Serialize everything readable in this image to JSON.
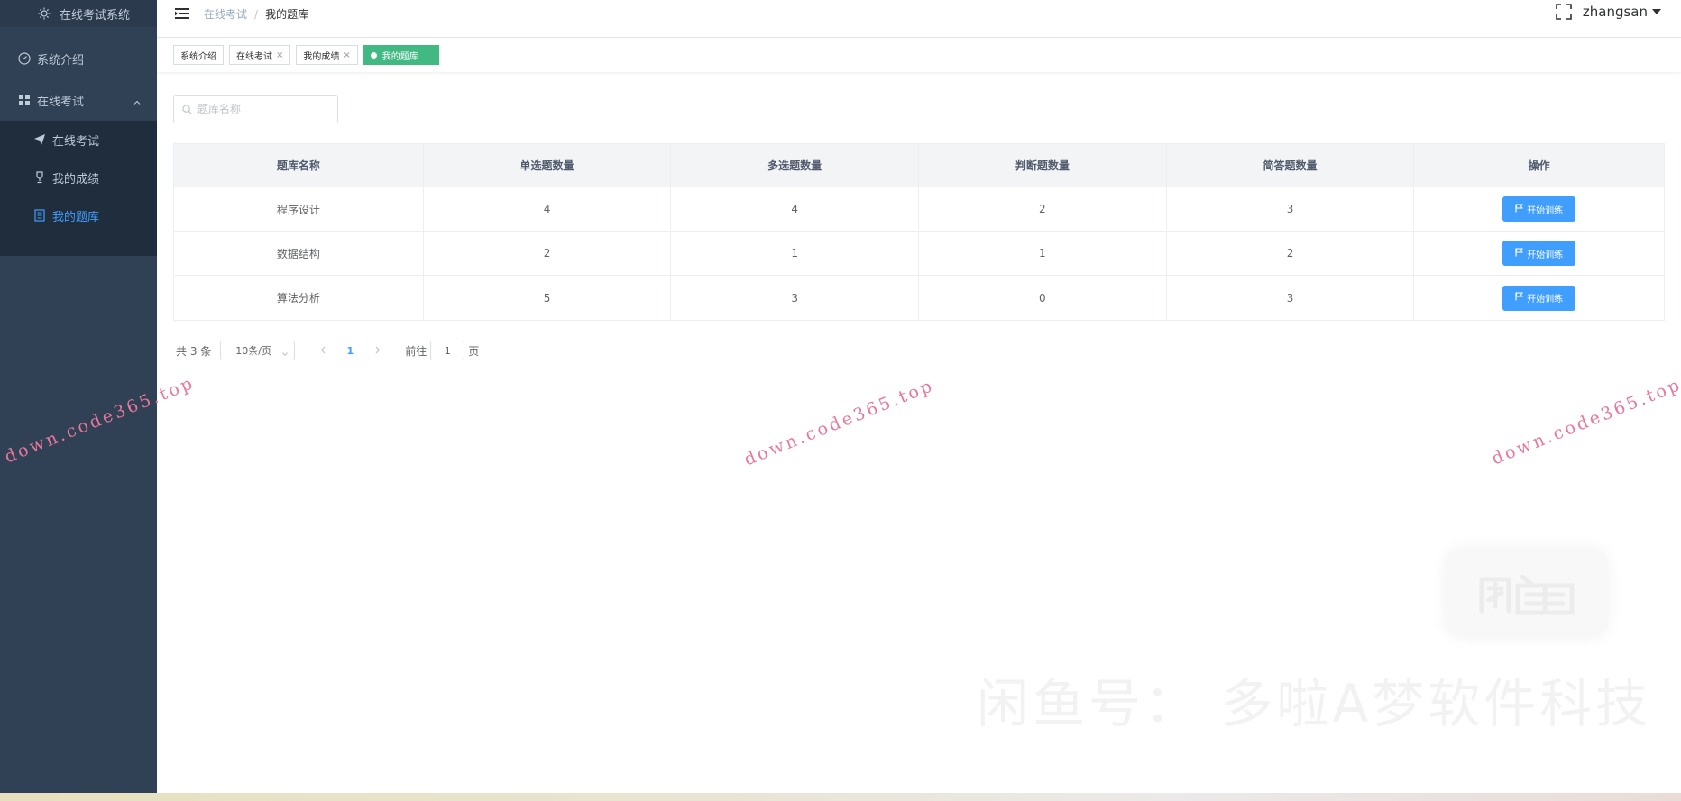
{
  "sidebar": {
    "logo_title": "在线考试系统",
    "items": [
      {
        "label": "系统介绍"
      },
      {
        "label": "在线考试"
      }
    ],
    "sub_items": [
      {
        "label": "在线考试"
      },
      {
        "label": "我的成绩"
      },
      {
        "label": "我的题库"
      }
    ],
    "active_color": "#409eff",
    "bg_color": "#304156"
  },
  "header": {
    "breadcrumb": [
      "在线考试",
      "我的题库"
    ],
    "breadcrumb_sep": "/",
    "username": "zhangsan"
  },
  "tags": [
    {
      "label": "系统介绍",
      "closable": false
    },
    {
      "label": "在线考试",
      "closable": true
    },
    {
      "label": "我的成绩",
      "closable": true
    },
    {
      "label": "我的题库",
      "active": true
    }
  ],
  "tag_close": "×",
  "search": {
    "placeholder": "题库名称"
  },
  "table": {
    "columns": [
      "题库名称",
      "单选题数量",
      "多选题数量",
      "判断题数量",
      "简答题数量",
      "操作"
    ],
    "rows": [
      {
        "name": "程序设计",
        "single": "4",
        "multi": "4",
        "judge": "2",
        "short": "3"
      },
      {
        "name": "数据结构",
        "single": "2",
        "multi": "1",
        "judge": "1",
        "short": "2"
      },
      {
        "name": "算法分析",
        "single": "5",
        "multi": "3",
        "judge": "0",
        "short": "3"
      }
    ],
    "action_label": "开始训练"
  },
  "pagination": {
    "total_text": "共 3 条",
    "page_size": "10条/页",
    "current_page": "1",
    "goto_prefix": "前往",
    "goto_value": "1",
    "goto_suffix": "页"
  },
  "watermarks": {
    "url": "down.code365.top",
    "big_text": "闲鱼号：  多啦A梦软件科技"
  },
  "colors": {
    "primary": "#409eff",
    "tag_active": "#42b983",
    "watermark": "#e8779a"
  }
}
